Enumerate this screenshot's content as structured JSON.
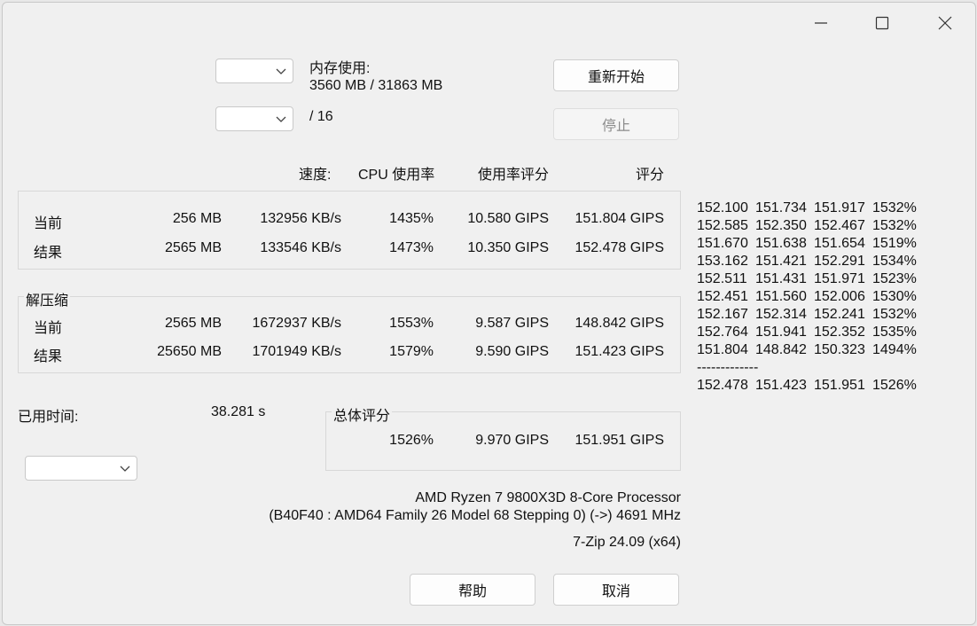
{
  "memory": {
    "label": "内存使用:",
    "value": "3560 MB / 31863 MB"
  },
  "threads": {
    "suffix": "/ 16"
  },
  "buttons": {
    "restart": "重新开始",
    "stop": "停止",
    "help": "帮助",
    "cancel": "取消"
  },
  "headers": {
    "speed": "速度:",
    "cpu_usage": "CPU 使用率",
    "usage_rating": "使用率评分",
    "rating": "评分"
  },
  "compress": {
    "rows": [
      {
        "label": "当前",
        "size": "256 MB",
        "speed": "132956 KB/s",
        "usage": "1435%",
        "usage_rating": "10.580 GIPS",
        "rating": "151.804 GIPS"
      },
      {
        "label": "结果",
        "size": "2565 MB",
        "speed": "133546 KB/s",
        "usage": "1473%",
        "usage_rating": "10.350 GIPS",
        "rating": "152.478 GIPS"
      }
    ]
  },
  "decompress": {
    "title": "解压缩",
    "rows": [
      {
        "label": "当前",
        "size": "2565 MB",
        "speed": "1672937 KB/s",
        "usage": "1553%",
        "usage_rating": "9.587 GIPS",
        "rating": "148.842 GIPS"
      },
      {
        "label": "结果",
        "size": "25650 MB",
        "speed": "1701949 KB/s",
        "usage": "1579%",
        "usage_rating": "9.590 GIPS",
        "rating": "151.423 GIPS"
      }
    ]
  },
  "elapsed": {
    "label": "已用时间:",
    "value": "38.281 s"
  },
  "total": {
    "title": "总体评分",
    "usage": "1526%",
    "usage_rating": "9.970 GIPS",
    "rating": "151.951 GIPS"
  },
  "cpu": {
    "name": "AMD Ryzen 7 9800X3D 8-Core Processor",
    "details": "(B40F40 : AMD64 Family 26 Model 68 Stepping 0) (->) 4691 MHz",
    "version": "7-Zip 24.09 (x64)"
  },
  "log": {
    "rows": [
      [
        "152.100",
        "151.734",
        "151.917",
        "1532%"
      ],
      [
        "152.585",
        "152.350",
        "152.467",
        "1532%"
      ],
      [
        "151.670",
        "151.638",
        "151.654",
        "1519%"
      ],
      [
        "153.162",
        "151.421",
        "152.291",
        "1534%"
      ],
      [
        "152.511",
        "151.431",
        "151.971",
        "1523%"
      ],
      [
        "152.451",
        "151.560",
        "152.006",
        "1530%"
      ],
      [
        "152.167",
        "152.314",
        "152.241",
        "1532%"
      ],
      [
        "152.764",
        "151.941",
        "152.352",
        "1535%"
      ],
      [
        "151.804",
        "148.842",
        "150.323",
        "1494%"
      ]
    ],
    "separator": "-------------",
    "summary": [
      "152.478",
      "151.423",
      "151.951",
      "1526%"
    ]
  }
}
